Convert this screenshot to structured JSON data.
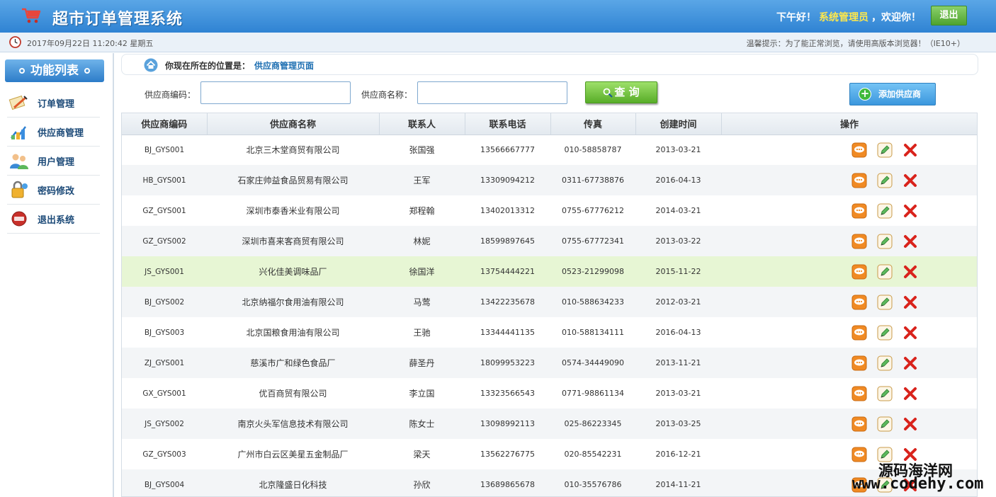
{
  "header": {
    "title": "超市订单管理系统",
    "greeting_prefix": "下午好！",
    "role": "系统管理员",
    "greeting_suffix": "，欢迎你！",
    "logout_label": "退出"
  },
  "subbar": {
    "datetime": "2017年09月22日 11:20:42 星期五",
    "tip": "温馨提示：为了能正常浏览，请使用高版本浏览器！（IE10+）"
  },
  "sidebar": {
    "title": "功能列表",
    "items": [
      {
        "label": "订单管理",
        "icon": "order-icon"
      },
      {
        "label": "供应商管理",
        "icon": "supplier-icon"
      },
      {
        "label": "用户管理",
        "icon": "users-icon"
      },
      {
        "label": "密码修改",
        "icon": "password-icon"
      },
      {
        "label": "退出系统",
        "icon": "exit-icon"
      }
    ]
  },
  "breadcrumb": {
    "prefix": "你现在所在的位置是：",
    "current": "供应商管理页面"
  },
  "search": {
    "code_label": "供应商编码：",
    "code_value": "",
    "name_label": "供应商名称：",
    "name_value": "",
    "query_label": "查 询",
    "add_label": "添加供应商"
  },
  "table": {
    "headers": [
      "供应商编码",
      "供应商名称",
      "联系人",
      "联系电话",
      "传真",
      "创建时间",
      "操作"
    ],
    "rows": [
      {
        "code": "BJ_GYS001",
        "name": "北京三木堂商贸有限公司",
        "contact": "张国强",
        "phone": "13566667777",
        "fax": "010-58858787",
        "created": "2013-03-21"
      },
      {
        "code": "HB_GYS001",
        "name": "石家庄帅益食品贸易有限公司",
        "contact": "王军",
        "phone": "13309094212",
        "fax": "0311-67738876",
        "created": "2016-04-13"
      },
      {
        "code": "GZ_GYS001",
        "name": "深圳市泰香米业有限公司",
        "contact": "郑程翰",
        "phone": "13402013312",
        "fax": "0755-67776212",
        "created": "2014-03-21"
      },
      {
        "code": "GZ_GYS002",
        "name": "深圳市喜来客商贸有限公司",
        "contact": "林妮",
        "phone": "18599897645",
        "fax": "0755-67772341",
        "created": "2013-03-22"
      },
      {
        "code": "JS_GYS001",
        "name": "兴化佳美调味品厂",
        "contact": "徐国洋",
        "phone": "13754444221",
        "fax": "0523-21299098",
        "created": "2015-11-22"
      },
      {
        "code": "BJ_GYS002",
        "name": "北京纳福尔食用油有限公司",
        "contact": "马莺",
        "phone": "13422235678",
        "fax": "010-588634233",
        "created": "2012-03-21"
      },
      {
        "code": "BJ_GYS003",
        "name": "北京国粮食用油有限公司",
        "contact": "王驰",
        "phone": "13344441135",
        "fax": "010-588134111",
        "created": "2016-04-13"
      },
      {
        "code": "ZJ_GYS001",
        "name": "慈溪市广和绿色食品厂",
        "contact": "薛圣丹",
        "phone": "18099953223",
        "fax": "0574-34449090",
        "created": "2013-11-21"
      },
      {
        "code": "GX_GYS001",
        "name": "优百商贸有限公司",
        "contact": "李立国",
        "phone": "13323566543",
        "fax": "0771-98861134",
        "created": "2013-03-21"
      },
      {
        "code": "JS_GYS002",
        "name": "南京火头军信息技术有限公司",
        "contact": "陈女士",
        "phone": "13098992113",
        "fax": "025-86223345",
        "created": "2013-03-25"
      },
      {
        "code": "GZ_GYS003",
        "name": "广州市白云区美星五金制品厂",
        "contact": "梁天",
        "phone": "13562276775",
        "fax": "020-85542231",
        "created": "2016-12-21"
      },
      {
        "code": "BJ_GYS004",
        "name": "北京隆盛日化科技",
        "contact": "孙欣",
        "phone": "13689865678",
        "fax": "010-35576786",
        "created": "2014-11-21"
      }
    ],
    "highlighted_row": 4
  },
  "watermark": {
    "line1": "源码海洋网",
    "line2": "www.codehy.com"
  }
}
